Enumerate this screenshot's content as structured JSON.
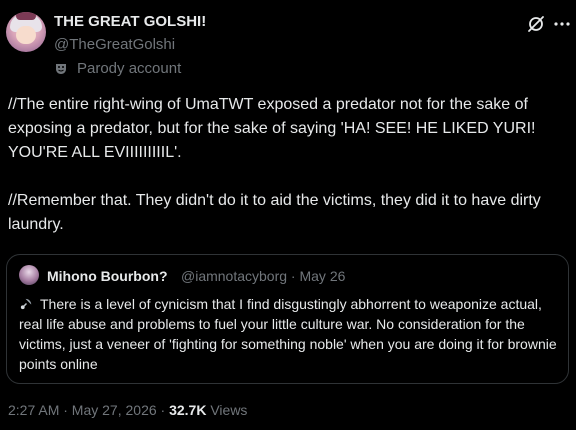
{
  "author": {
    "name": "THE GREAT GOLSHI!",
    "handle": "@TheGreatGolshi",
    "label": "Parody account"
  },
  "tweet": {
    "text": "//The entire right-wing of UmaTWT exposed a predator not for the sake of exposing a predator, but for the sake of saying 'HA! SEE! HE LIKED YURI! YOU'RE ALL EVIIIIIIIIIL'.\n\n//Remember that. They didn't do it to aid the victims, they did it to have dirty laundry."
  },
  "quoted": {
    "name": "Mihono Bourbon?",
    "meta": "@iamnotacyborg · May 26",
    "text": "There is a level of cynicism that I find disgustingly abhorrent to weaponize actual, real life abuse and problems to fuel your little culture war. No consideration for the victims, just a veneer of 'fighting for something noble' when you are doing it for brownie points online"
  },
  "footer": {
    "timestamp": "2:27 AM · May 27, 2026 · ",
    "views_count": "32.7K",
    "views_label": " Views"
  },
  "icons": {
    "parody": "theater-mask-icon",
    "grok": "grok-icon",
    "more": "more-icon",
    "emoji": "satellite-emoji-icon"
  },
  "colors": {
    "background": "#000000",
    "primary_text": "#e7e9ea",
    "secondary_text": "#71767b",
    "border": "#2f3336"
  }
}
